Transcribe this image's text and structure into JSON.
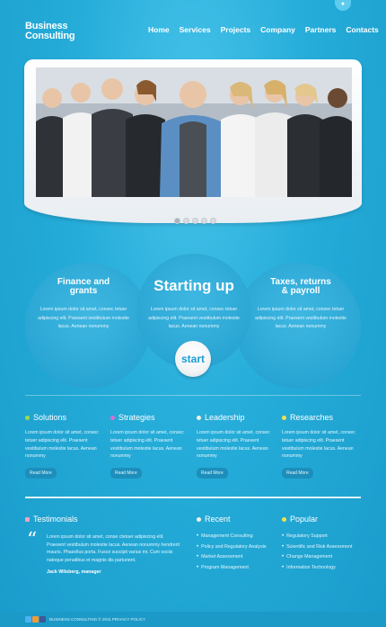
{
  "header": {
    "logo_line1": "Business",
    "logo_line2": "Consulting",
    "nav": [
      "Home",
      "Services",
      "Projects",
      "Company",
      "Partners",
      "Contacts"
    ]
  },
  "slider": {
    "slides": 5,
    "active_slide": 1
  },
  "features": {
    "left": {
      "title_line1": "Finance and",
      "title_line2": "grants",
      "text": "Lorem ipsum dolor sit amet, consec tetuer adipiscing elit. Praesent vestibulum molestie lacus. Aenean nonummy"
    },
    "middle": {
      "title": "Starting up",
      "text": "Lorem ipsum dolor sit amet, consec tetuer adipiscing elit. Praesent vestibulum molestie lacus. Aenean nonummy"
    },
    "right": {
      "title_line1": "Taxes, returns",
      "title_line2": "& payroll",
      "text": "Lorem ipsum dolor sit amet, consec tetuer adipiscing elit. Praesent vestibulum molestie lacus. Aenean nonummy"
    },
    "start_label": "start"
  },
  "columns": [
    {
      "title": "Solutions",
      "text": "Lorem ipsum dolor sit amet, consec tetuer adipiscing elit. Praesent vestibulum molestie lacus. Aenean nonummy",
      "button": "Read More",
      "bullet_color": "#9ed84a"
    },
    {
      "title": "Strategies",
      "text": "Lorem ipsum dolor sit amet, consec tetuer adipiscing elit. Praesent vestibulum molestie lacus. Aenean nonummy",
      "button": "Read More",
      "bullet_color": "#d86fd0"
    },
    {
      "title": "Leadership",
      "text": "Lorem ipsum dolor sit amet, consec tetuer adipiscing elit. Praesent vestibulum molestie lacus. Aenean nonummy",
      "button": "Read More",
      "bullet_color": "#f3f0e4"
    },
    {
      "title": "Researches",
      "text": "Lorem ipsum dolor sit amet, consec tetuer adipiscing elit. Praesent vestibulum molestie lacus. Aenean nonummy",
      "button": "Read More",
      "bullet_color": "#f1e04f"
    }
  ],
  "testimonials": {
    "title": "Testimonials",
    "quote_mark": "“",
    "text": "Lorem ipsum dolor sit amet, conse ctetuer adipiscing elit. Praesent vestibulum molestie lacus. Aenean nonummy hendrerit mauris. Phasellus porta. Fusce suscipit varius mi. Cum sociis natoque penatibus et magnis dis parturient.",
    "author": "Jack Wilsberg, manager"
  },
  "recent": {
    "title": "Recent",
    "items": [
      "Management Consulting",
      "Policy and Regulatory Analysis",
      "Market Assessment",
      "Program Management"
    ]
  },
  "popular": {
    "title": "Popular",
    "items": [
      "Regulatory Support",
      "Scientific and Risk Assessment",
      "Change Management",
      "Information Technology"
    ]
  },
  "footer": {
    "text": "BUSINESS CONSULTING © 2011  PRIVACY POLICY"
  }
}
